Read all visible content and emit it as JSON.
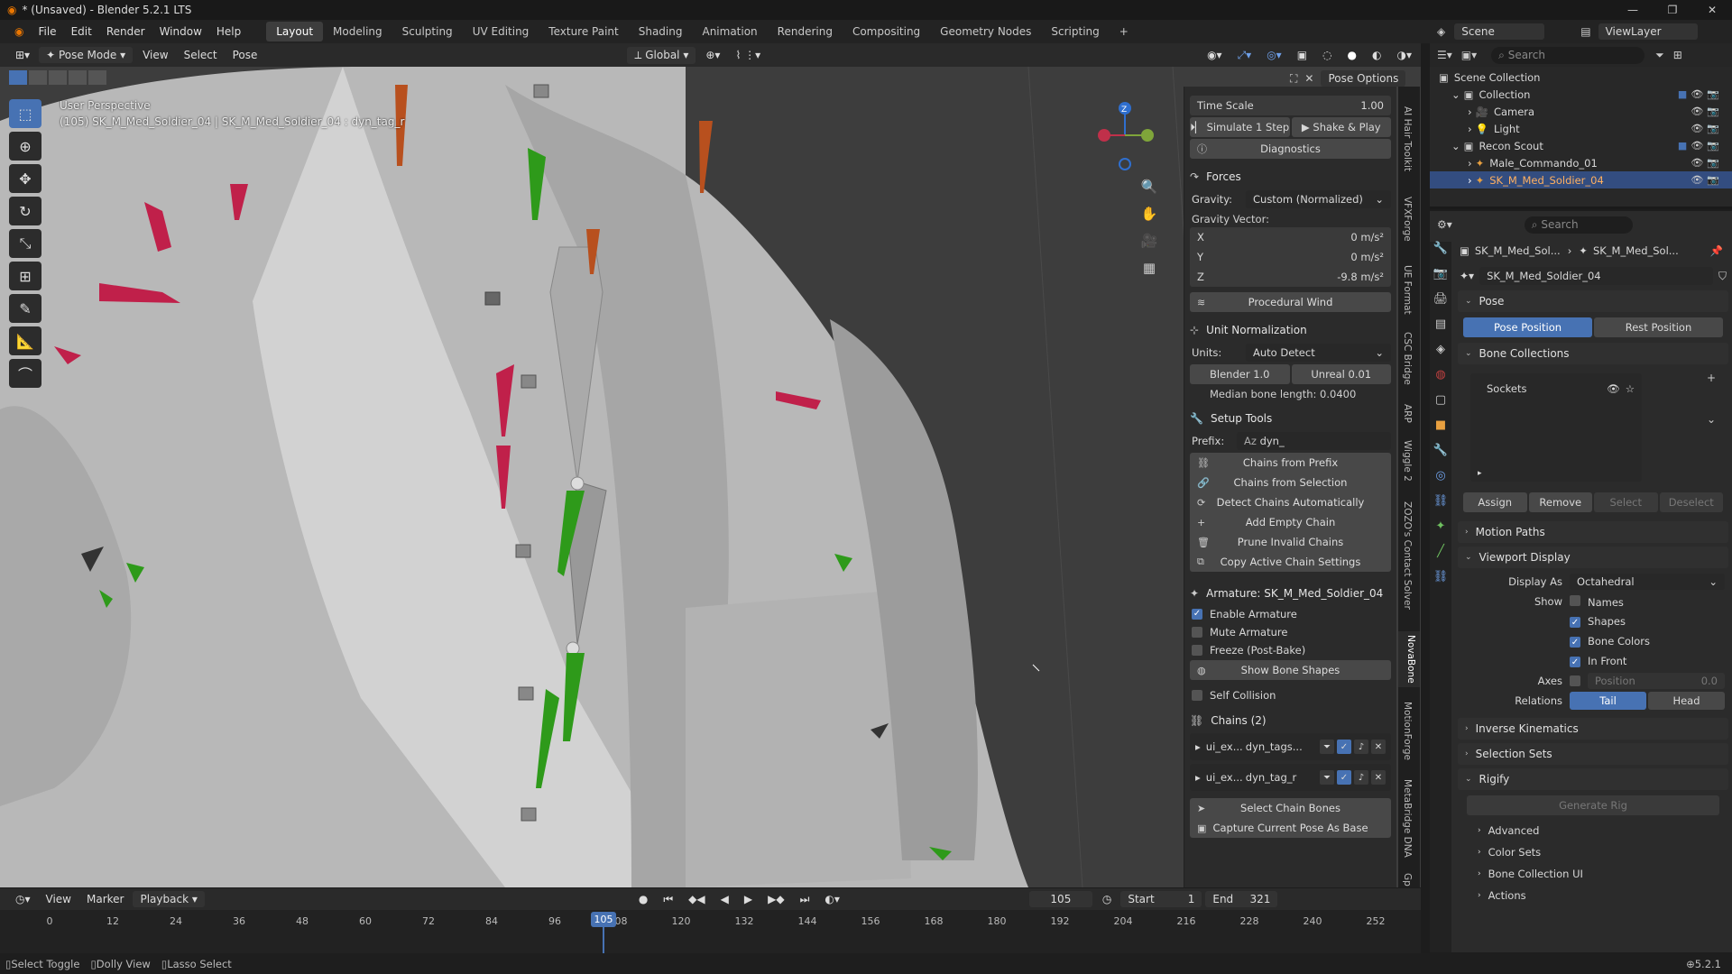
{
  "title": "* (Unsaved) - Blender 5.2.1 LTS",
  "menu": [
    "File",
    "Edit",
    "Render",
    "Window",
    "Help"
  ],
  "workspaces": [
    "Layout",
    "Modeling",
    "Sculpting",
    "UV Editing",
    "Texture Paint",
    "Shading",
    "Animation",
    "Rendering",
    "Compositing",
    "Geometry Nodes",
    "Scripting"
  ],
  "active_workspace": "Layout",
  "scene": {
    "label": "Scene",
    "view_layer": "ViewLayer"
  },
  "viewport_header": {
    "mode": "Pose Mode",
    "view": "View",
    "select": "Select",
    "pose": "Pose",
    "orientation": "Global",
    "pose_options": "Pose Options"
  },
  "viewport_info": {
    "line1": "User Perspective",
    "line2": "(105) SK_M_Med_Soldier_04 | SK_M_Med_Soldier_04 : dyn_tag_r"
  },
  "gizmo": {
    "z": "Z"
  },
  "npanel": {
    "time_scale_label": "Time Scale",
    "time_scale_value": "1.00",
    "simulate_step": "Simulate 1 Step",
    "shake_play": "Shake & Play",
    "diagnostics": "Diagnostics",
    "forces_title": "Forces",
    "gravity_label": "Gravity:",
    "gravity_value": "Custom (Normalized)",
    "gravity_vector_label": "Gravity Vector:",
    "gx_label": "X",
    "gx": "0 m/s²",
    "gy_label": "Y",
    "gy": "0 m/s²",
    "gz_label": "Z",
    "gz": "-9.8 m/s²",
    "procedural_wind": "Procedural Wind",
    "unit_title": "Unit Normalization",
    "units_label": "Units:",
    "units_value": "Auto Detect",
    "blender_btn": "Blender 1.0",
    "unreal_btn": "Unreal 0.01",
    "median": "Median bone length: 0.0400",
    "setup_title": "Setup Tools",
    "prefix_label": "Prefix:",
    "prefix_value": "dyn_",
    "setup_buttons": [
      "Chains from Prefix",
      "Chains from Selection",
      "Detect Chains Automatically",
      "Add Empty Chain",
      "Prune Invalid Chains",
      "Copy Active Chain Settings"
    ],
    "armature_title": "Armature: SK_M_Med_Soldier_04",
    "enable_armature": "Enable Armature",
    "mute_armature": "Mute Armature",
    "freeze": "Freeze (Post-Bake)",
    "show_bone_shapes": "Show Bone Shapes",
    "self_collision": "Self Collision",
    "chains_title": "Chains (2)",
    "chains": [
      {
        "a": "ui_ex...",
        "b": "dyn_tags..."
      },
      {
        "a": "ui_ex...",
        "b": "dyn_tag_r"
      }
    ],
    "select_chain_bones": "Select Chain Bones",
    "capture_pose": "Capture Current Pose As Base"
  },
  "vtabs": [
    "AI Hair Toolkit",
    "VFXForge",
    "UE Format",
    "CSC Bridge",
    "ARP",
    "Wiggle 2",
    "ZOZO's Contact Solver",
    "NovaBone",
    "MotionForge",
    "MetaBridge DNA",
    "Gp"
  ],
  "timeline": {
    "menus": [
      "View",
      "Marker",
      "Playback"
    ],
    "current": "105",
    "start_label": "Start",
    "start": "1",
    "end_label": "End",
    "end": "321",
    "ticks": [
      "0",
      "12",
      "24",
      "36",
      "48",
      "60",
      "72",
      "84",
      "96",
      "108",
      "120",
      "132",
      "144",
      "156",
      "168",
      "180",
      "192",
      "204",
      "216",
      "228",
      "240",
      "252"
    ]
  },
  "status": {
    "a": "Select Toggle",
    "b": "Dolly View",
    "c": "Lasso Select",
    "version": "5.2.1"
  },
  "outliner": {
    "search": "Search",
    "rows": [
      {
        "name": "Scene Collection",
        "indent": 0
      },
      {
        "name": "Collection",
        "indent": 1
      },
      {
        "name": "Camera",
        "indent": 2
      },
      {
        "name": "Light",
        "indent": 2
      },
      {
        "name": "Recon Scout",
        "indent": 1
      },
      {
        "name": "Male_Commando_01",
        "indent": 2
      },
      {
        "name": "SK_M_Med_Soldier_04",
        "indent": 2
      }
    ]
  },
  "props": {
    "search": "Search",
    "bc1": "SK_M_Med_Sol...",
    "bc2": "SK_M_Med_Sol...",
    "data_name": "SK_M_Med_Soldier_04",
    "pose": "Pose",
    "pose_position": "Pose Position",
    "rest_position": "Rest Position",
    "bone_collections": "Bone Collections",
    "sockets": "Sockets",
    "assign": "Assign",
    "remove": "Remove",
    "select": "Select",
    "deselect": "Deselect",
    "motion_paths": "Motion Paths",
    "viewport_display": "Viewport Display",
    "display_as_label": "Display As",
    "display_as": "Octahedral",
    "show_label": "Show",
    "names": "Names",
    "shapes": "Shapes",
    "bone_colors": "Bone Colors",
    "in_front": "In Front",
    "axes_label": "Axes",
    "position": "Position",
    "position_val": "0.0",
    "relations_label": "Relations",
    "tail": "Tail",
    "head": "Head",
    "ik": "Inverse Kinematics",
    "selection_sets": "Selection Sets",
    "rigify": "Rigify",
    "generate_rig": "Generate Rig",
    "advanced": "Advanced",
    "color_sets": "Color Sets",
    "bone_collection_ui": "Bone Collection UI",
    "actions": "Actions"
  },
  "colors": {
    "accent": "#4772b3",
    "bone_green": "#2e9a1a",
    "bone_red": "#c0204a",
    "bone_orange": "#b8501e"
  }
}
